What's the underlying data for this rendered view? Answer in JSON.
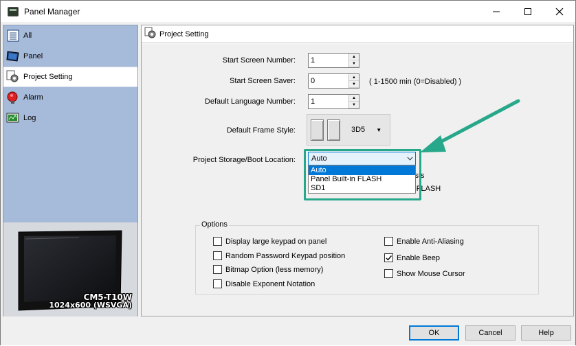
{
  "window": {
    "title": "Panel Manager",
    "minimize_label": "—",
    "maximize_label": "☐",
    "close_label": "✕"
  },
  "sidebar": {
    "items": [
      {
        "label": "All",
        "icon": "grid-icon"
      },
      {
        "label": "Panel",
        "icon": "panel-icon"
      },
      {
        "label": "Project Setting",
        "icon": "gear-icon"
      },
      {
        "label": "Alarm",
        "icon": "alarm-icon"
      },
      {
        "label": "Log",
        "icon": "log-icon"
      }
    ],
    "selected_index": 2,
    "panel_model": "CM5-T10W",
    "panel_resolution": "1024x600 (WSVGA)"
  },
  "main": {
    "header": "Project Setting",
    "start_screen_number": {
      "label": "Start Screen Number:",
      "value": "1"
    },
    "start_screen_saver": {
      "label": "Start Screen Saver:",
      "value": "0",
      "hint": "( 1-1500 min (0=Disabled) )"
    },
    "default_language_number": {
      "label": "Default Language Number:",
      "value": "1"
    },
    "default_frame_style": {
      "label": "Default Frame Style:",
      "value": "3D5"
    },
    "storage_boot_location": {
      "label": "Project Storage/Boot Location:",
      "value": "Auto",
      "options": [
        "Auto",
        "Panel Built-in FLASH",
        "SD1"
      ],
      "selected_option": 0
    },
    "obscured_text": [
      "ists",
      "n-FLASH"
    ],
    "options": {
      "legend": "Options",
      "left": [
        {
          "label": "Display large keypad on panel",
          "checked": false
        },
        {
          "label": "Random Password Keypad position",
          "checked": false
        },
        {
          "label": "Bitmap Option (less memory)",
          "checked": false
        },
        {
          "label": "Disable Exponent Notation",
          "checked": false
        }
      ],
      "right": [
        {
          "label": "Enable Anti-Aliasing",
          "checked": false
        },
        {
          "label": "Enable Beep",
          "checked": true
        },
        {
          "label": "Show Mouse Cursor",
          "checked": false
        }
      ]
    }
  },
  "buttons": {
    "ok": "OK",
    "cancel": "Cancel",
    "help": "Help"
  },
  "colors": {
    "sidebar_bg": "#a6bad9",
    "highlight": "#27a88a",
    "accent": "#0078d7"
  }
}
